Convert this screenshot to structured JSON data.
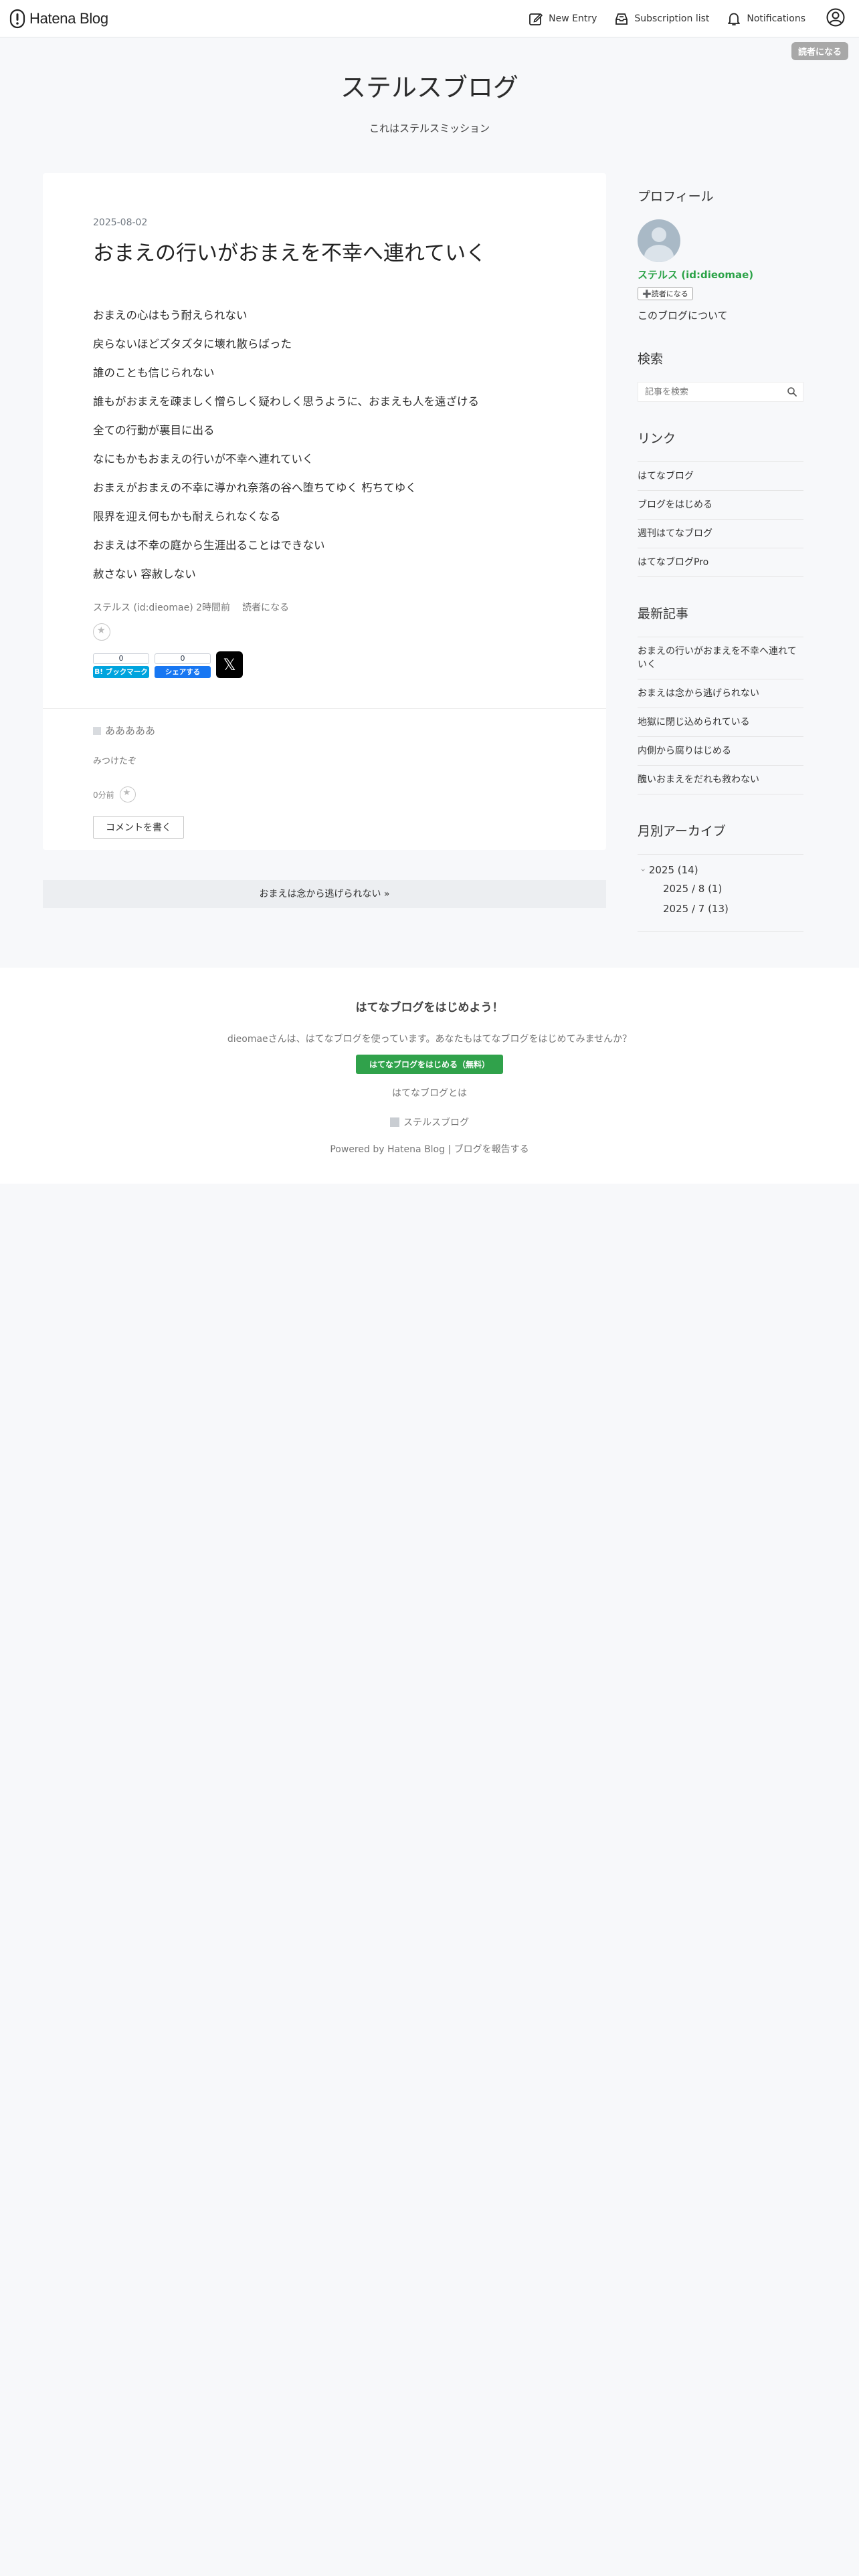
{
  "topbar": {
    "logo_text": "Hatena Blog",
    "new_entry": "New Entry",
    "subscription_list": "Subscription list",
    "notifications": "Notifications"
  },
  "follow_button": "読者になる",
  "blog": {
    "title": "ステルスブログ",
    "description": "これはステルスミッション"
  },
  "entry": {
    "date": "2025-08-02",
    "title": "おまえの行いがおまえを不幸へ連れていく",
    "paragraphs": [
      "おまえの心はもう耐えられない",
      "戻らないほどズタズタに壊れ散らばった",
      "誰のことも信じられない",
      "誰もがおまえを疎ましく憎らしく疑わしく思うように、おまえも人を遠ざける",
      "全ての行動が裏目に出る",
      "なにもかもおまえの行いが不幸へ連れていく",
      "おまえがおまえの不幸に導かれ奈落の谷へ堕ちてゆく 朽ちてゆく",
      "限界を迎え何もかも耐えられなくなる",
      "おまえは不幸の庭から生涯出ることはできない",
      "赦さない 容赦しない"
    ],
    "author": "ステルス (id:dieomae)",
    "time_ago": "2時間前",
    "subscribe_link": "読者になる",
    "hatena_count": "0",
    "hatena_label": "B! ブックマーク",
    "fb_count": "0",
    "fb_label": "シェアする",
    "x_label": "𝕏"
  },
  "comment": {
    "author": "あああああ",
    "body": "みつけたぞ",
    "time": "0分前",
    "write_button": "コメントを書く"
  },
  "pager": {
    "next": "おまえは念から逃げられない »"
  },
  "sidebar": {
    "profile_title": "プロフィール",
    "profile_name": "ステルス (id:dieomae)",
    "profile_follow": "➕読者になる",
    "profile_about": "このブログについて",
    "search_title": "検索",
    "search_placeholder": "記事を検索",
    "links_title": "リンク",
    "links": [
      "はてなブログ",
      "ブログをはじめる",
      "週刊はてなブログ",
      "はてなブログPro"
    ],
    "recent_title": "最新記事",
    "recent": [
      "おまえの行いがおまえを不幸へ連れていく",
      "おまえは念から逃げられない",
      "地獄に閉じ込められている",
      "内側から腐りはじめる",
      "醜いおまえをだれも救わない"
    ],
    "archive_title": "月別アーカイブ",
    "archive_year": "2025 (14)",
    "archive_months": [
      "2025 / 8 (1)",
      "2025 / 7 (13)"
    ]
  },
  "footer": {
    "title": "はてなブログをはじめよう！",
    "message": "dieomaeさんは、はてなブログを使っています。あなたもはてなブログをはじめてみませんか？",
    "cta": "はてなブログをはじめる（無料）",
    "about": "はてなブログとは",
    "blog_name": "ステルスブログ",
    "powered": "Powered by Hatena Blog",
    "separator": " | ",
    "report": "ブログを報告する"
  }
}
